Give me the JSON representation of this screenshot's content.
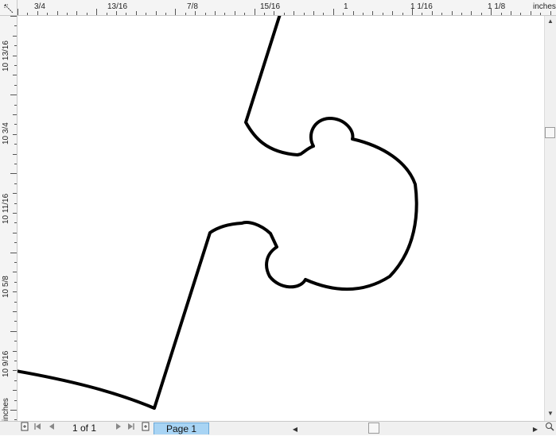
{
  "ruler": {
    "unit_top": "inches",
    "unit_side": "inches",
    "top_labels": [
      "3/4",
      "13/16",
      "7/8",
      "15/16",
      "1",
      "1  1/16",
      "1  1/8"
    ],
    "side_labels": [
      "10  13/16",
      "10  3/4",
      "10  11/16",
      "10  5/8",
      "10  9/16"
    ]
  },
  "navigation": {
    "page_count": "1 of 1",
    "active_page_tab": "Page 1"
  },
  "icons": {
    "corner": "ruler-corner-icon",
    "add_page_before": "add-page-icon",
    "first_page": "first-page-icon",
    "prev_page": "prev-page-icon",
    "next_page": "next-page-icon",
    "last_page": "last-page-icon",
    "add_page_after": "add-page-icon",
    "zoom": "zoom-icon"
  },
  "colors": {
    "shape_stroke": "#000000",
    "active_tab": "#a8d4f4"
  }
}
